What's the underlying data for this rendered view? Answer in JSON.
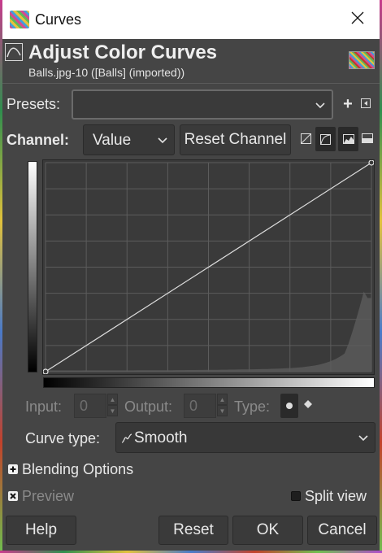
{
  "window": {
    "title": "Curves",
    "close_symbol": "✕"
  },
  "header": {
    "title": "Adjust Color Curves",
    "subtitle": "Balls.jpg-10 ([Balls] (imported))"
  },
  "presets": {
    "label": "Presets:",
    "value": "",
    "add_symbol": "+"
  },
  "channel": {
    "label": "Channel:",
    "value": "Value",
    "reset_label": "Reset Channel"
  },
  "graph": {
    "curve_points": [
      [
        0,
        0
      ],
      [
        255,
        255
      ]
    ],
    "histogram_peak_fraction": 0.44,
    "grid_divisions": 8
  },
  "io": {
    "input_label": "Input:",
    "input_value": "0",
    "output_label": "Output:",
    "output_value": "0",
    "type_label": "Type:"
  },
  "curve_type": {
    "label": "Curve type:",
    "value": "Smooth"
  },
  "blending": {
    "label": "Blending Options"
  },
  "preview": {
    "label": "Preview",
    "checked": true
  },
  "split_view": {
    "label": "Split view",
    "checked": false
  },
  "buttons": {
    "help": "Help",
    "reset": "Reset",
    "ok": "OK",
    "cancel": "Cancel"
  }
}
